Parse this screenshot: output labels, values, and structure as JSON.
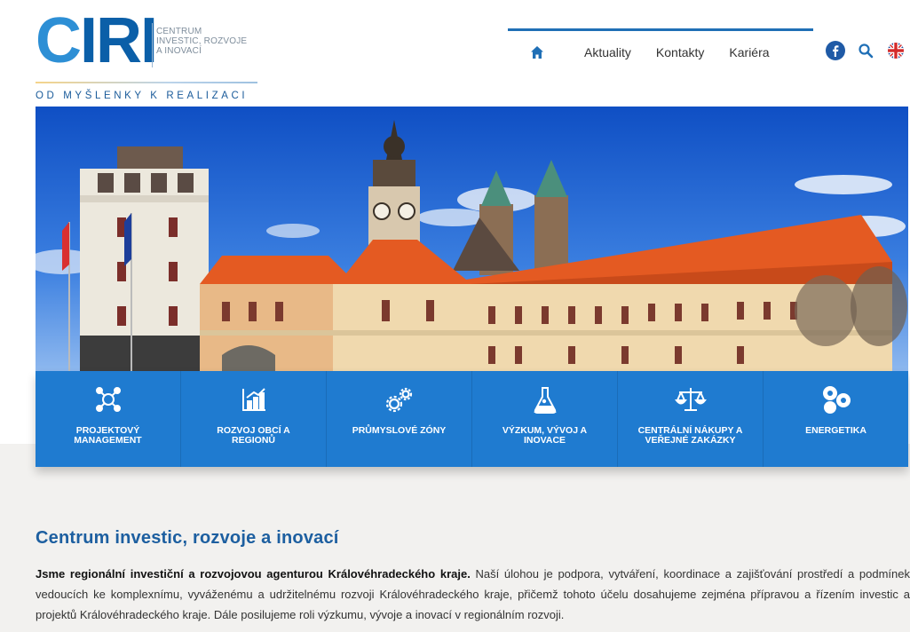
{
  "logo": {
    "word": "CIRI",
    "subtitle_lines": [
      "CENTRUM",
      "INVESTIC, ROZVOJE",
      "A INOVACÍ"
    ],
    "tagline": "OD MYŠLENKY K REALIZACI"
  },
  "nav": {
    "home_icon": "home-icon",
    "items": [
      "Aktuality",
      "Kontakty",
      "Kariéra"
    ],
    "icons": [
      "facebook-icon",
      "search-icon",
      "uk-flag-icon"
    ]
  },
  "services": [
    {
      "label": "PROJEKTOVÝ MANAGEMENT",
      "icon": "project-management-icon"
    },
    {
      "label": "ROZVOJ OBCÍ A REGIONŮ",
      "icon": "growth-chart-icon"
    },
    {
      "label": "PRŮMYSLOVÉ ZÓNY",
      "icon": "gears-icon"
    },
    {
      "label": "VÝZKUM, VÝVOJ A INOVACE",
      "icon": "flask-icon"
    },
    {
      "label": "CENTRÁLNÍ NÁKUPY A VEŘEJNÉ ZAKÁZKY",
      "icon": "scales-icon"
    },
    {
      "label": "ENERGETIKA",
      "icon": "energy-icon"
    }
  ],
  "content": {
    "title": "Centrum investic, rozvoje a inovací",
    "lead_bold": "Jsme regionální investiční a rozvojovou agenturou Královéhradeckého kraje.",
    "lead_rest": " Naší úlohou je podpora, vytváření, koordinace a zajišťování prostředí a podmínek vedoucích ke komplexnímu, vyváženému a udržitelnému rozvoji Královéhradeckého kraje, přičemž tohoto účelu dosahujeme zejména přípravou a řízením investic a projektů Královéhradeckého kraje. Dále posilujeme roli výzkumu, vývoje a inovací v regionálním rozvoji."
  },
  "colors": {
    "brand_blue": "#1f7bd0",
    "title_blue": "#1d5fa0",
    "nav_accent": "#1f6fb6"
  }
}
